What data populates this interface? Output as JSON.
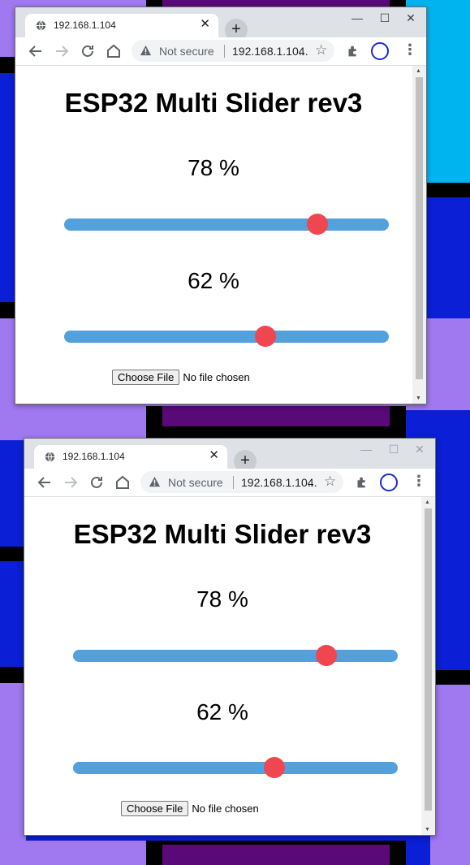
{
  "windows": [
    {
      "tab_title": "192.168.1.104",
      "not_secure": "Not secure",
      "url": "192.168.1.104",
      "heading": "ESP32 Multi Slider rev3",
      "sliders": [
        {
          "label": "78 %",
          "value": 78
        },
        {
          "label": "62 %",
          "value": 62
        }
      ],
      "choose_file": "Choose File",
      "no_file": "No file chosen"
    },
    {
      "tab_title": "192.168.1.104",
      "not_secure": "Not secure",
      "url": "192.168.1.104",
      "heading": "ESP32 Multi Slider rev3",
      "sliders": [
        {
          "label": "78 %",
          "value": 78
        },
        {
          "label": "62 %",
          "value": 62
        }
      ],
      "choose_file": "Choose File",
      "no_file": "No file chosen"
    }
  ],
  "colors": {
    "slider_track": "#52a0dc",
    "slider_knob": "#f04650",
    "desktop_blue": "#0a1fd6",
    "desktop_cyan": "#00b4f0",
    "desktop_purple": "#a078f0",
    "desktop_dark_purple": "#5a0a78"
  },
  "icons": {
    "tab": "globe-icon",
    "close": "close-icon",
    "new_tab": "plus-icon",
    "back": "arrow-left-icon",
    "forward": "arrow-right-icon",
    "reload": "reload-icon",
    "home": "home-icon",
    "warning": "warning-icon",
    "bookmark": "star-icon",
    "extensions": "puzzle-icon",
    "profile": "profile-icon",
    "menu": "kebab-menu-icon"
  }
}
